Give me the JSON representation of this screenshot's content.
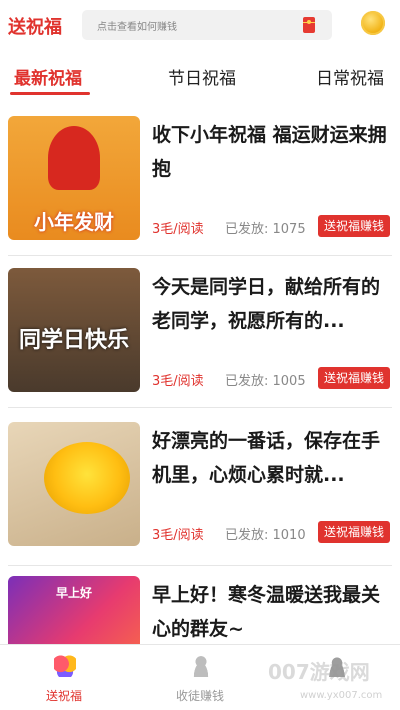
{
  "header": {
    "app_title": "送祝福",
    "search_placeholder": "点击查看如何赚钱",
    "icons": {
      "redpacket": "redpacket-icon",
      "coin": "coin-icon"
    }
  },
  "tabs": [
    {
      "label": "最新祝福",
      "active": true
    },
    {
      "label": "节日祝福",
      "active": false
    },
    {
      "label": "日常祝福",
      "active": false
    }
  ],
  "feed": [
    {
      "title": "收下小年祝福 福运财运来拥抱",
      "thumb_caption": "小年发财",
      "price": "3毛/阅读",
      "issued": "已发放: 1075",
      "cta": "送祝福赚钱"
    },
    {
      "title": "今天是同学日，献给所有的老同学，祝愿所有的...",
      "thumb_caption": "同学日快乐",
      "price": "3毛/阅读",
      "issued": "已发放: 1005",
      "cta": "送祝福赚钱"
    },
    {
      "title": "好漂亮的一番话，保存在手机里，心烦心累时就...",
      "thumb_caption": "",
      "price": "3毛/阅读",
      "issued": "已发放: 1010",
      "cta": "送祝福赚钱"
    },
    {
      "title": "早上好！寒冬温暖送我最关心的群友~",
      "thumb_caption": "早上好",
      "price": "",
      "issued": "",
      "cta": ""
    }
  ],
  "bottom_nav": [
    {
      "label": "送祝福",
      "icon": "hearts-icon",
      "active": true
    },
    {
      "label": "收徒赚钱",
      "icon": "person-icon",
      "active": false
    },
    {
      "label": "",
      "icon": "user-icon",
      "active": false
    }
  ],
  "watermark": {
    "text": "007游戏网",
    "url": "www.yx007.com"
  },
  "colors": {
    "accent": "#e0332e",
    "divider": "#e6e6e6",
    "muted": "#888888"
  }
}
